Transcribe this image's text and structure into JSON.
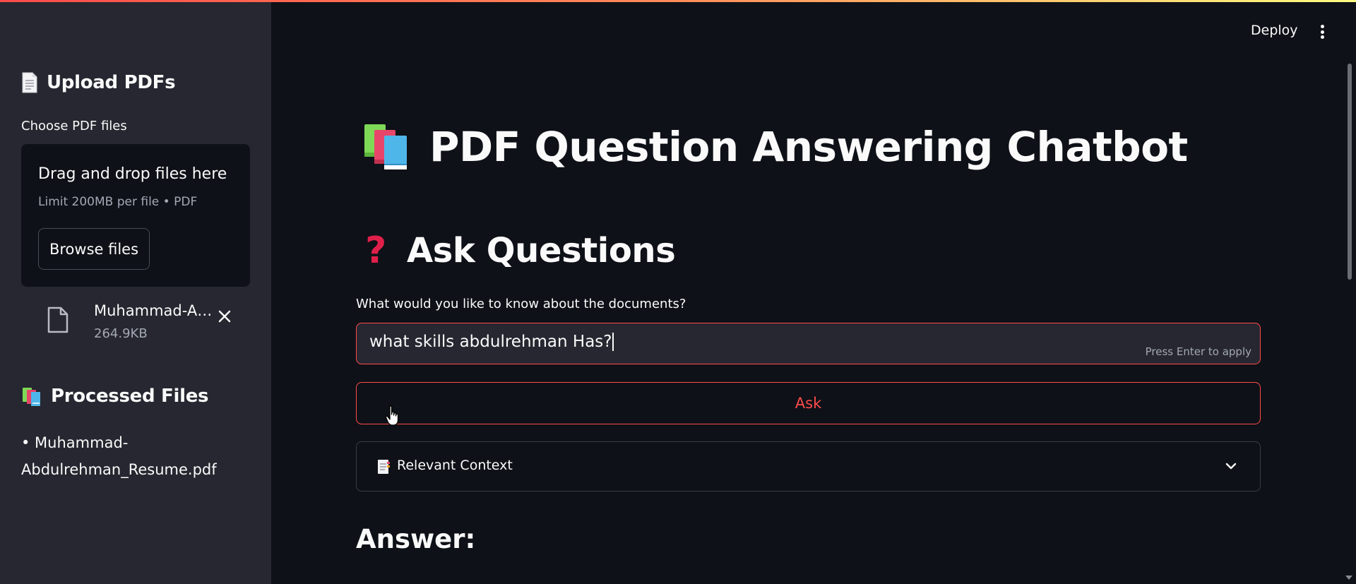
{
  "header": {
    "deploy_label": "Deploy"
  },
  "sidebar": {
    "upload_heading": "Upload PDFs",
    "choose_label": "Choose PDF files",
    "dropzone": {
      "title": "Drag and drop files here",
      "limit": "Limit 200MB per file • PDF",
      "browse_label": "Browse files"
    },
    "uploaded_file": {
      "name": "Muhammad-Abdulrehman_Resume.pdf",
      "size": "264.9KB"
    },
    "processed_heading": "Processed Files",
    "processed_items": [
      "• Muhammad-Abdulrehman_Resume.pdf"
    ]
  },
  "main": {
    "title": "PDF Question Answering Chatbot",
    "ask_heading": "Ask Questions",
    "question_label": "What would you like to know about the documents?",
    "question_value": "what skills abdulrehman Has?",
    "input_hint": "Press Enter to apply",
    "ask_button": "Ask",
    "expander_label": "Relevant Context",
    "answer_heading": "Answer:"
  },
  "colors": {
    "background": "#0e1117",
    "sidebar": "#262730",
    "accent": "#ff4b4b"
  },
  "icons": {
    "upload_heading": "page-icon",
    "processed_heading": "books-icon",
    "title": "books-icon",
    "ask_heading": "red-question-mark-icon",
    "file": "file-icon",
    "remove_file": "close-icon",
    "expander": "bookmark-tabs-icon",
    "expander_toggle": "chevron-down-icon",
    "menu": "kebab-menu-icon"
  }
}
